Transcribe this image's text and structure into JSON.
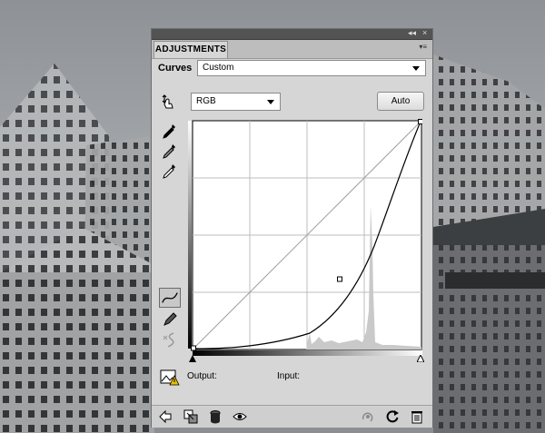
{
  "panel": {
    "tab_label": "ADJUSTMENTS",
    "collapse_glyph": "◂◂",
    "close_glyph": "×",
    "menu_glyph": "▾≡"
  },
  "curves": {
    "label": "Curves",
    "preset_value": "Custom",
    "channel_value": "RGB",
    "auto_label": "Auto",
    "output_label": "Output:",
    "input_label": "Input:",
    "points": [
      [
        0,
        0
      ],
      [
        131,
        36
      ],
      [
        255,
        255
      ]
    ]
  },
  "icons": {
    "tools": [
      "targeted-adjustment-icon",
      "black-eyedropper-icon",
      "gray-eyedropper-icon",
      "white-eyedropper-icon",
      "curve-points-icon",
      "pencil-icon",
      "smooth-icon",
      "clipping-warning-icon"
    ],
    "bottom": [
      "back-arrow-icon",
      "clip-to-layer-icon",
      "layer-visibility-mask-icon",
      "eye-icon",
      "previous-state-icon",
      "reset-icon",
      "trash-icon"
    ]
  }
}
